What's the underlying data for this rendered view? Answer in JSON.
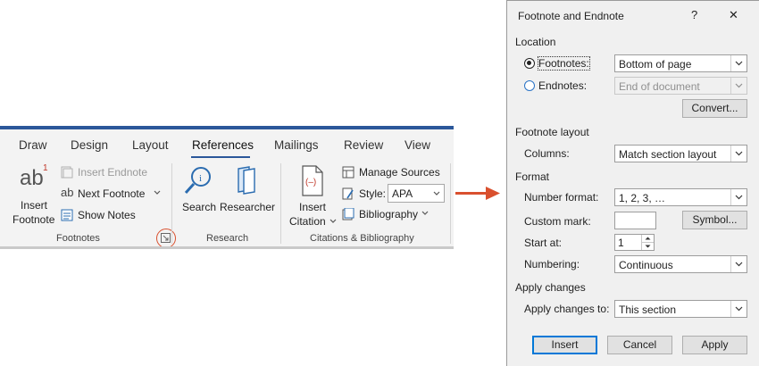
{
  "ribbon": {
    "tabs": [
      "Draw",
      "Design",
      "Layout",
      "References",
      "Mailings",
      "Review",
      "View"
    ],
    "footnotes_group": {
      "insert_footnote": [
        "Insert",
        "Footnote"
      ],
      "insert_endnote": "Insert Endnote",
      "next_footnote": "Next Footnote",
      "show_notes": "Show Notes",
      "label": "Footnotes"
    },
    "research_group": {
      "search": "Search",
      "researcher": "Researcher",
      "label": "Research"
    },
    "citations_group": {
      "insert_citation": [
        "Insert",
        "Citation"
      ],
      "manage_sources": "Manage Sources",
      "style_label": "Style:",
      "style_value": "APA",
      "bibliography": "Bibliography",
      "label": "Citations & Bibliography"
    },
    "glyphs": {
      "ab": "ab",
      "ab_sup": "1",
      "ab_small": "ab",
      "citation_icon": "(—)"
    }
  },
  "dialog": {
    "title": "Footnote and Endnote",
    "help": "?",
    "close": "✕",
    "location": {
      "title": "Location",
      "footnotes_label": "Footnotes:",
      "footnotes_value": "Bottom of page",
      "endnotes_label": "Endnotes:",
      "endnotes_value": "End of document",
      "convert": "Convert..."
    },
    "layout": {
      "title": "Footnote layout",
      "columns_label": "Columns:",
      "columns_value": "Match section layout"
    },
    "format": {
      "title": "Format",
      "number_format_label": "Number format:",
      "number_format_value": "1, 2, 3, …",
      "custom_mark_label": "Custom mark:",
      "custom_mark_value": "",
      "symbol": "Symbol...",
      "start_at_label": "Start at:",
      "start_at_value": "1",
      "numbering_label": "Numbering:",
      "numbering_value": "Continuous"
    },
    "apply": {
      "title": "Apply changes",
      "apply_to_label": "Apply changes to:",
      "apply_to_value": "This section"
    },
    "buttons": {
      "insert": "Insert",
      "cancel": "Cancel",
      "apply": "Apply"
    }
  },
  "colors": {
    "accent": "#2b579a",
    "highlight": "#d9502e",
    "focus": "#0078d7"
  }
}
